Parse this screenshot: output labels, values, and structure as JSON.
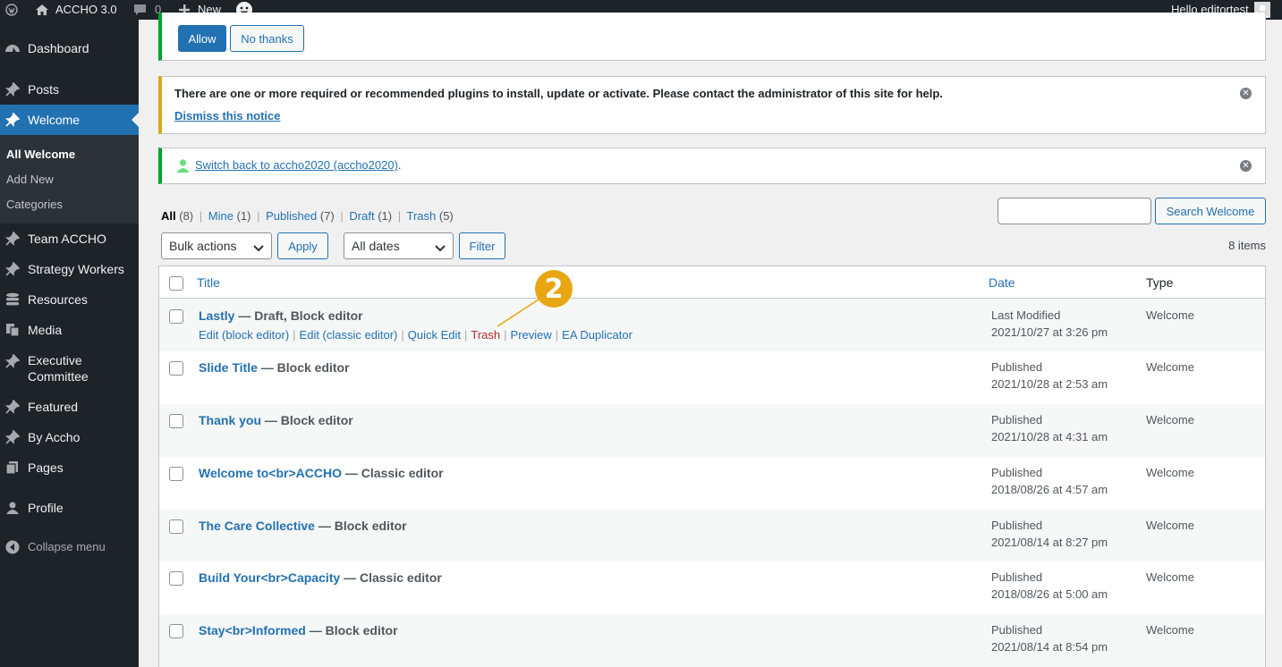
{
  "adminbar": {
    "site_name": "ACCHO 3.0",
    "comments_count": "0",
    "new_label": "New",
    "greeting": "Hello editortest"
  },
  "sidebar": {
    "items": [
      {
        "label": "Dashboard",
        "icon": "dashboard-icon"
      },
      {
        "label": "Posts",
        "icon": "pin-icon"
      },
      {
        "label": "Welcome",
        "icon": "pin-icon"
      },
      {
        "label": "Team ACCHO",
        "icon": "pin-icon"
      },
      {
        "label": "Strategy Workers",
        "icon": "pin-icon"
      },
      {
        "label": "Resources",
        "icon": "database-icon"
      },
      {
        "label": "Media",
        "icon": "media-icon"
      },
      {
        "label": "Executive",
        "label2": "Committee",
        "icon": "pin-icon"
      },
      {
        "label": "Featured",
        "icon": "pin-icon"
      },
      {
        "label": "By Accho",
        "icon": "pin-icon"
      },
      {
        "label": "Pages",
        "icon": "pages-icon"
      },
      {
        "label": "Profile",
        "icon": "user-icon"
      },
      {
        "label": "Collapse menu",
        "icon": "collapse-icon"
      }
    ],
    "submenu": [
      "All Welcome",
      "Add New",
      "Categories"
    ]
  },
  "notices": {
    "allow_label": "Allow",
    "no_thanks_label": "No thanks",
    "plugins_text": "There are one or more required or recommended plugins to install, update or activate. Please contact the administrator of this site for help.",
    "dismiss_label": "Dismiss this notice",
    "switch_back_link": "Switch back to accho2020 (accho2020)",
    "switch_back_suffix": "."
  },
  "filters": {
    "all": "All",
    "all_count": "(8)",
    "mine": "Mine",
    "mine_count": "(1)",
    "published": "Published",
    "published_count": "(7)",
    "draft": "Draft",
    "draft_count": "(1)",
    "trash": "Trash",
    "trash_count": "(5)",
    "sep": "|",
    "search_button": "Search Welcome",
    "bulk_actions": "Bulk actions",
    "apply": "Apply",
    "all_dates": "All dates",
    "filter": "Filter",
    "items_count": "8 items"
  },
  "table": {
    "headers": {
      "title": "Title",
      "date": "Date",
      "type": "Type"
    },
    "row_actions": [
      "Edit (block editor)",
      "Edit (classic editor)",
      "Quick Edit",
      "Trash",
      "Preview",
      "EA Duplicator"
    ],
    "rows": [
      {
        "title": "Lastly",
        "state": " — Draft, Block editor",
        "status": "Last Modified",
        "date": "2021/10/27 at 3:26 pm",
        "type": "Welcome"
      },
      {
        "title": "Slide Title",
        "state": " — Block editor",
        "status": "Published",
        "date": "2021/10/28 at 2:53 am",
        "type": "Welcome"
      },
      {
        "title": "Thank you",
        "state": " — Block editor",
        "status": "Published",
        "date": "2021/10/28 at 4:31 am",
        "type": "Welcome"
      },
      {
        "title": "Welcome to<br>ACCHO",
        "state": " — Classic editor",
        "status": "Published",
        "date": "2018/08/26 at 4:57 am",
        "type": "Welcome"
      },
      {
        "title": "The Care Collective",
        "state": " — Block editor",
        "status": "Published",
        "date": "2021/08/14 at 8:27 pm",
        "type": "Welcome"
      },
      {
        "title": "Build Your<br>Capacity",
        "state": " — Classic editor",
        "status": "Published",
        "date": "2018/08/26 at 5:00 am",
        "type": "Welcome"
      },
      {
        "title": "Stay<br>Informed",
        "state": " — Block editor",
        "status": "Published",
        "date": "2021/08/14 at 8:54 pm",
        "type": "Welcome"
      }
    ]
  },
  "callout": {
    "number": "2",
    "color": "#e8a712"
  },
  "colors": {
    "accent": "#2271b1",
    "sidebar": "#1d2327",
    "trash": "#b32d2e",
    "notice_warning": "#dba617",
    "notice_success": "#00a32a"
  }
}
